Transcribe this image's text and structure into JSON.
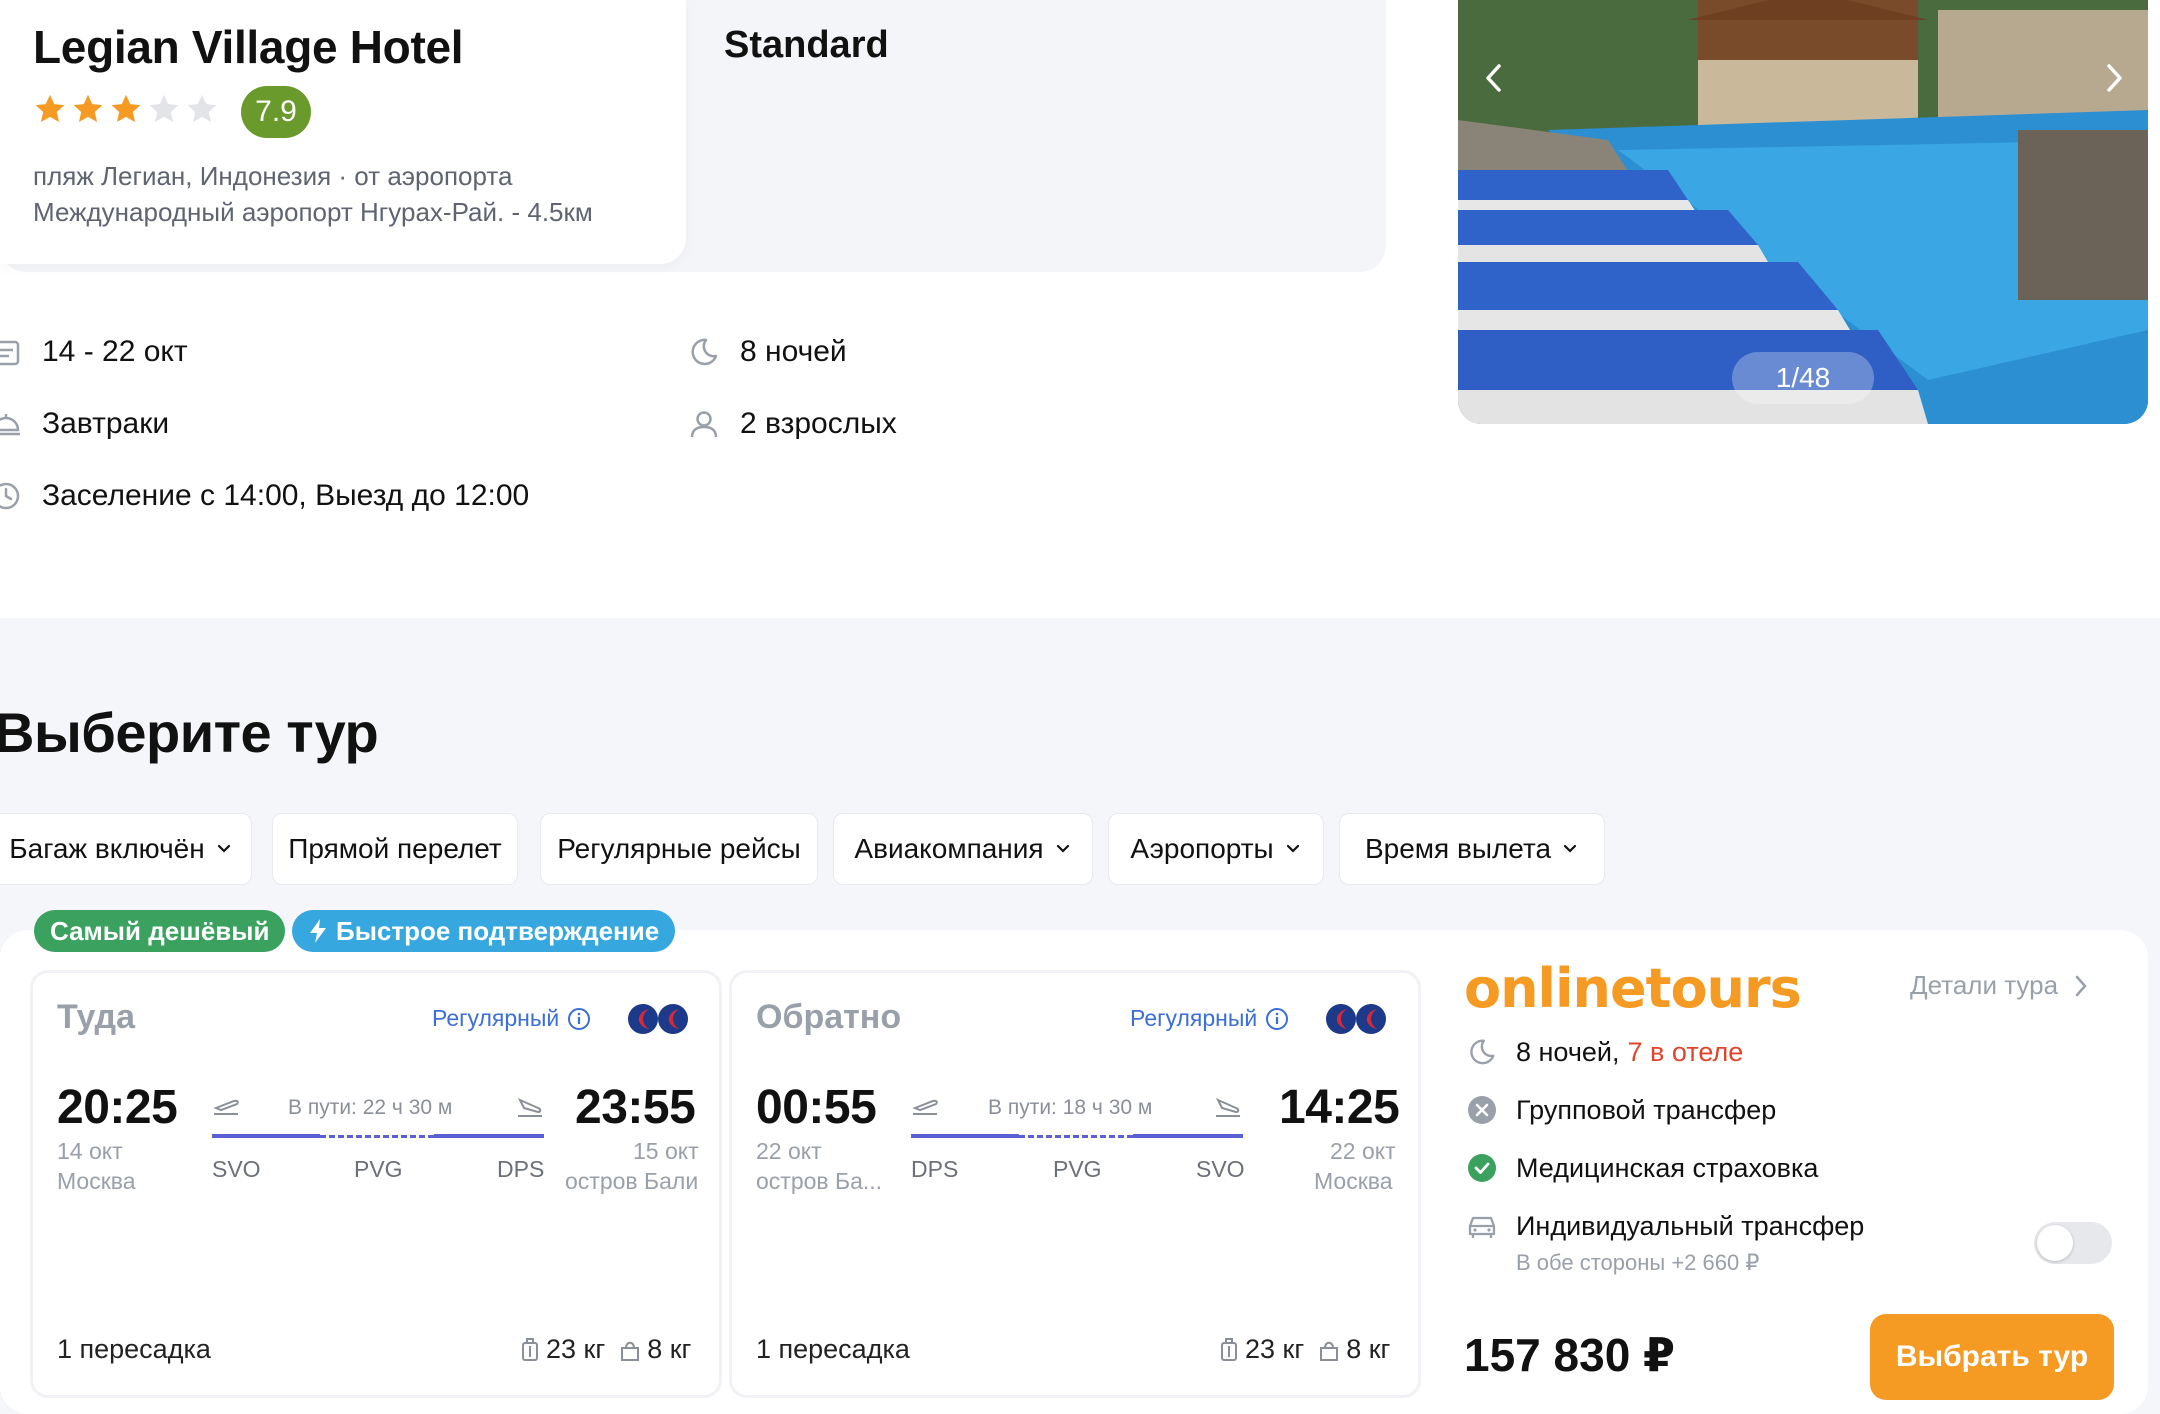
{
  "hotel": {
    "name": "Legian Village Hotel",
    "stars": 3,
    "rating": "7.9",
    "location_line1": "пляж Легиан, Индонезия · от аэропорта",
    "location_line2": "Международный аэропорт Нгурах-Рай. - 4.5км"
  },
  "room": {
    "name": "Standard"
  },
  "gallery": {
    "counter": "1/48"
  },
  "info": {
    "dates": "14 - 22 окт",
    "nights": "8 ночей",
    "meal": "Завтраки",
    "guests": "2 взрослых",
    "checkin": "Заселение с 14:00, Выезд до 12:00"
  },
  "section_title": "Выберите тур",
  "filters": [
    {
      "label": "Багаж включён",
      "dropdown": true
    },
    {
      "label": "Прямой перелет",
      "dropdown": false
    },
    {
      "label": "Регулярные рейсы",
      "dropdown": false
    },
    {
      "label": "Авиакомпания",
      "dropdown": true
    },
    {
      "label": "Аэропорты",
      "dropdown": true
    },
    {
      "label": "Время вылета",
      "dropdown": true
    }
  ],
  "badges": {
    "cheapest": "Самый дешёвый",
    "fast_confirm": "Быстрое подтверждение"
  },
  "outbound": {
    "title": "Туда",
    "type": "Регулярный",
    "dep_time": "20:25",
    "dep_date": "14 окт",
    "dep_city": "Москва",
    "duration": "В пути: 22 ч 30 м",
    "arr_time": "23:55",
    "arr_date": "15 окт",
    "arr_city": "остров Бали",
    "codes": [
      "SVO",
      "PVG",
      "DPS"
    ],
    "stops": "1 пересадка",
    "baggage": "23 кг",
    "hand_luggage": "8 кг"
  },
  "return": {
    "title": "Обратно",
    "type": "Регулярный",
    "dep_time": "00:55",
    "dep_date": "22 окт",
    "dep_city": "остров Ба...",
    "duration": "В пути: 18 ч 30 м",
    "arr_time": "14:25",
    "arr_date": "22 окт",
    "arr_city": "Москва",
    "codes": [
      "DPS",
      "PVG",
      "SVO"
    ],
    "stops": "1 пересадка",
    "baggage": "23 кг",
    "hand_luggage": "8 кг"
  },
  "operator": {
    "logo_text": "onlinetours",
    "details_link": "Детали тура",
    "nights": "8 ночей,",
    "nights_in_hotel": "7 в отеле",
    "group_transfer": "Групповой трансфер",
    "insurance": "Медицинская страховка",
    "individual_transfer": "Индивидуальный трансфер",
    "individual_transfer_note": "В обе стороны +2 660 ₽",
    "individual_transfer_enabled": false
  },
  "price": "157 830 ₽",
  "select_button": "Выбрать тур",
  "colors": {
    "accent_orange": "#f59a23",
    "rating_green": "#6a9a2c",
    "badge_green": "#3aa15e",
    "badge_blue": "#36a8df",
    "route_blue": "#5a5fd6",
    "link_blue": "#3b6fd8",
    "nights_red": "#e0452b"
  }
}
